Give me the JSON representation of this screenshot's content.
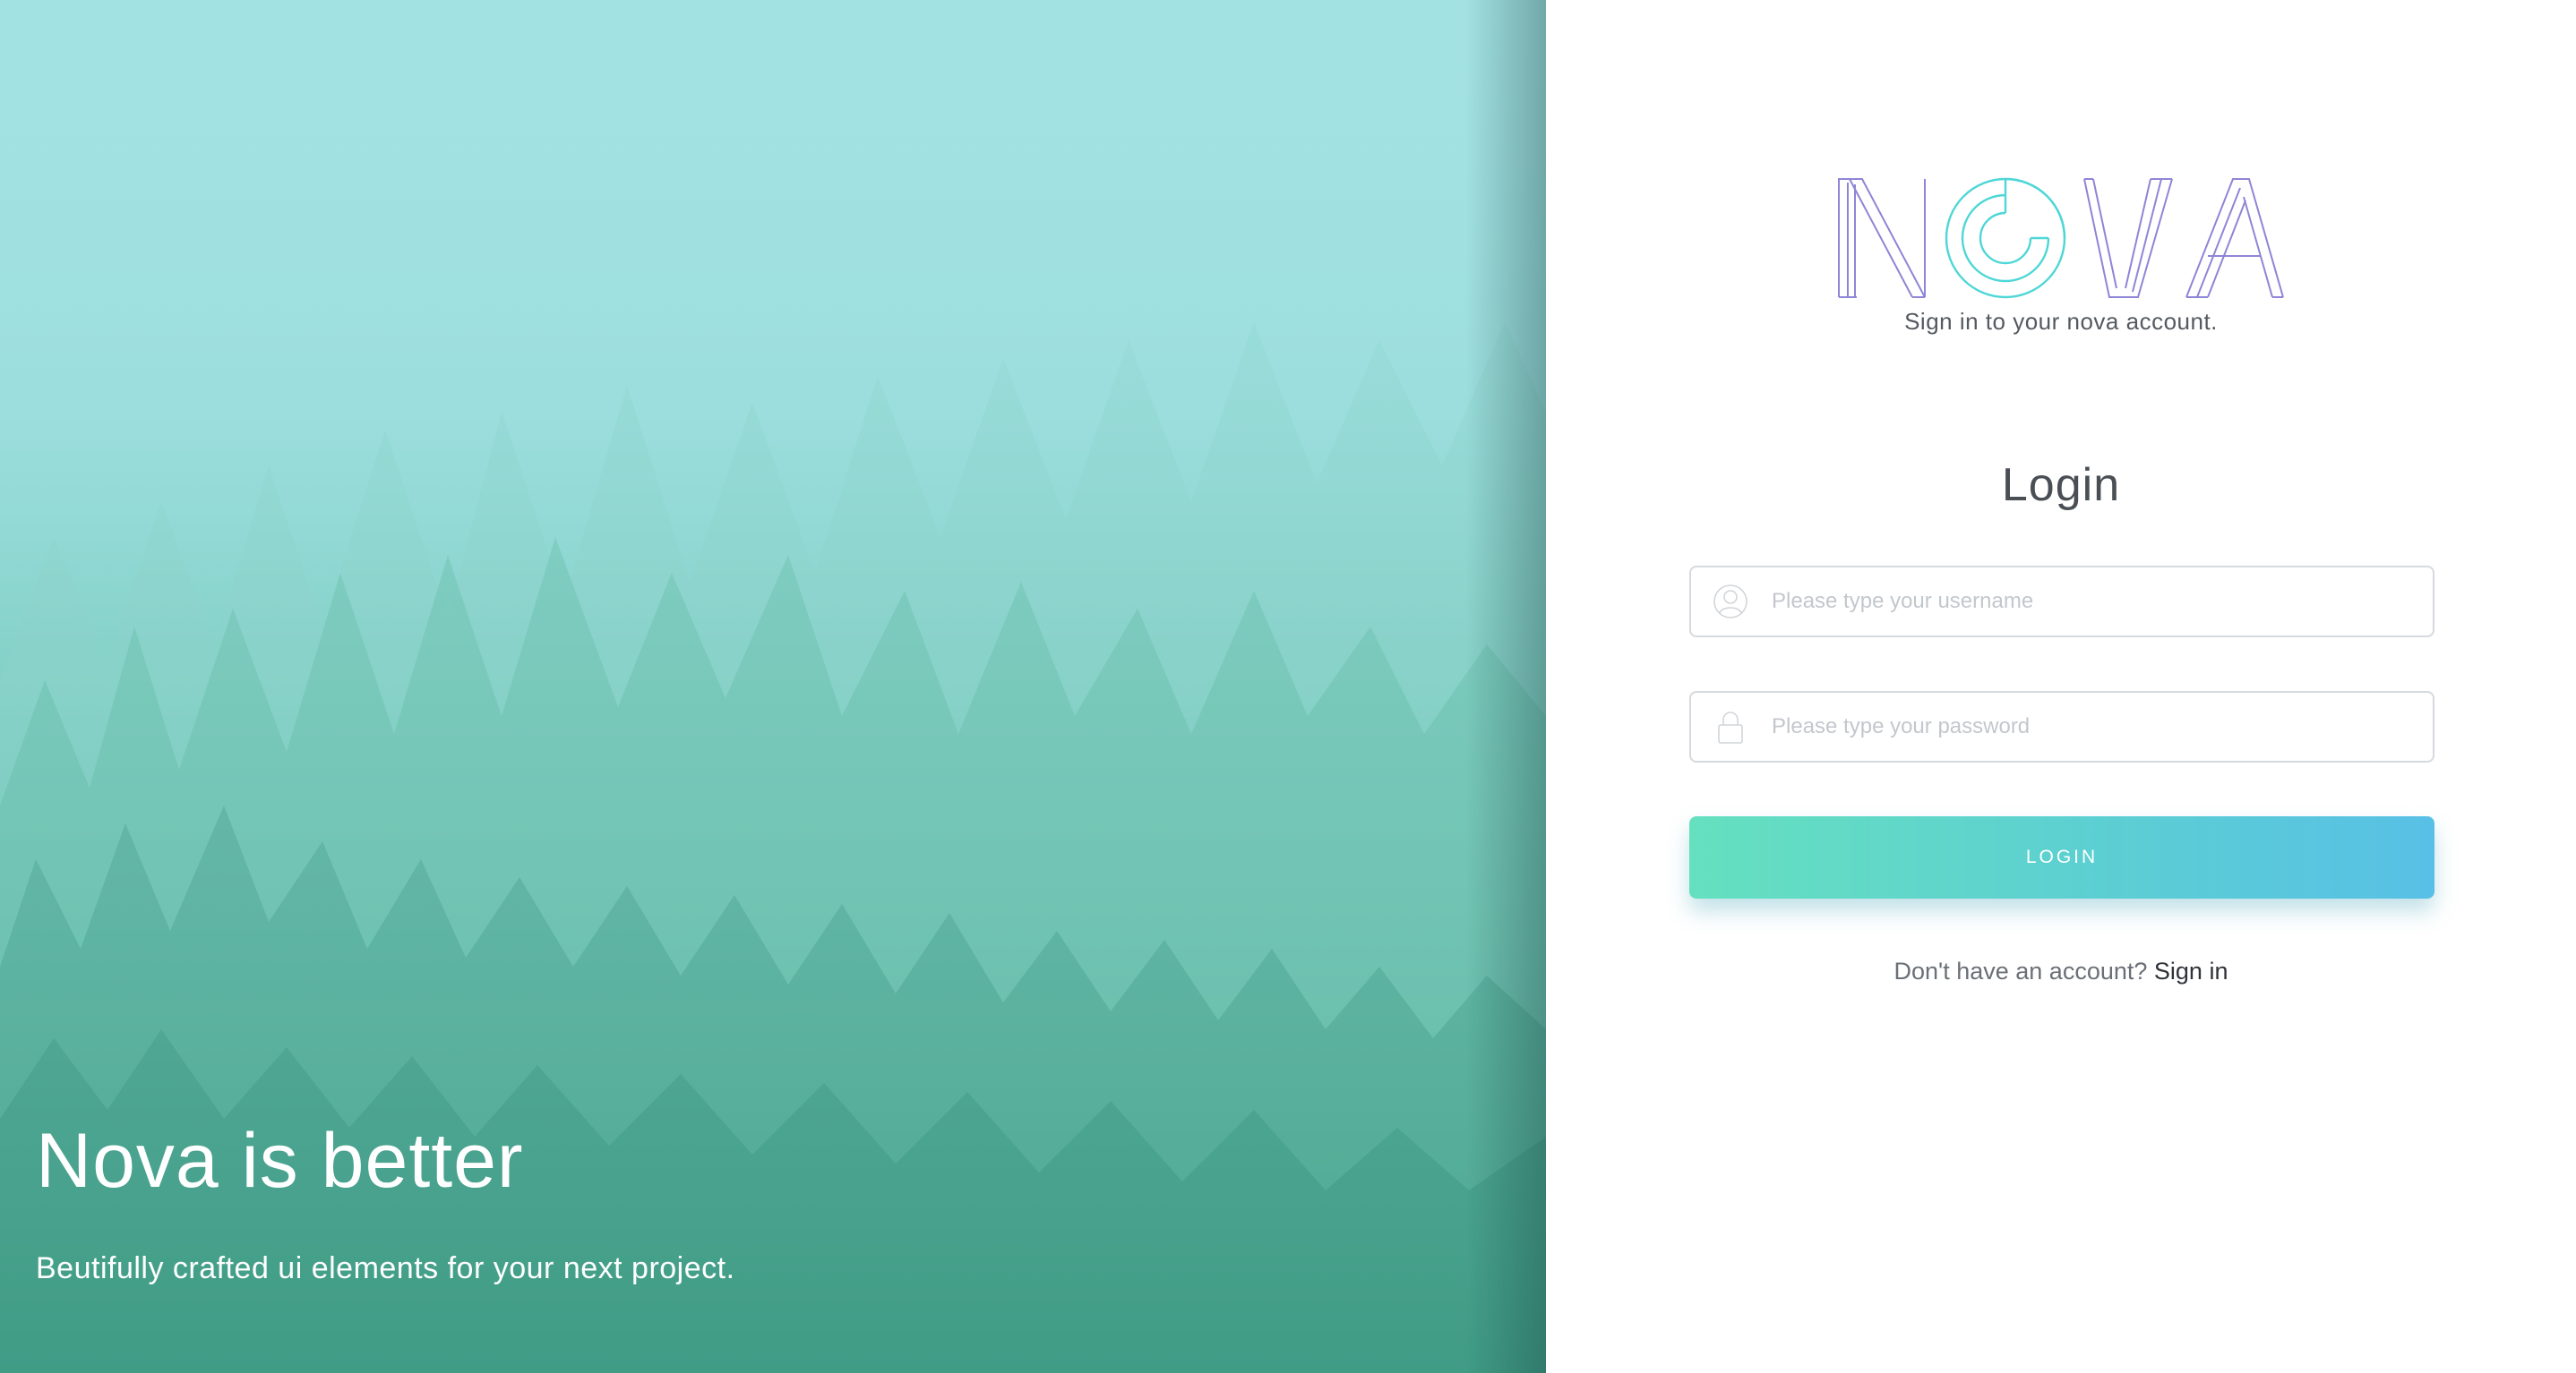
{
  "hero": {
    "title": "Nova is better",
    "subtitle": "Beutifully crafted ui elements for your next project."
  },
  "brand": {
    "logo_text": "NOVA",
    "tagline": "Sign in to your nova account.",
    "logo_colors": {
      "letters": "#8f85d6",
      "circle": "#4fd6d6"
    }
  },
  "login": {
    "heading": "Login",
    "username": {
      "icon": "user-icon",
      "value": "",
      "placeholder": "Please type your username"
    },
    "password": {
      "icon": "lock-icon",
      "value": "",
      "placeholder": "Please type your password"
    },
    "button_label": "LOGIN",
    "button_colors": {
      "start": "#65e0bf",
      "end": "#58c0e6"
    },
    "signup_prompt": "Don't have an account?",
    "signup_link": "Sign in"
  }
}
